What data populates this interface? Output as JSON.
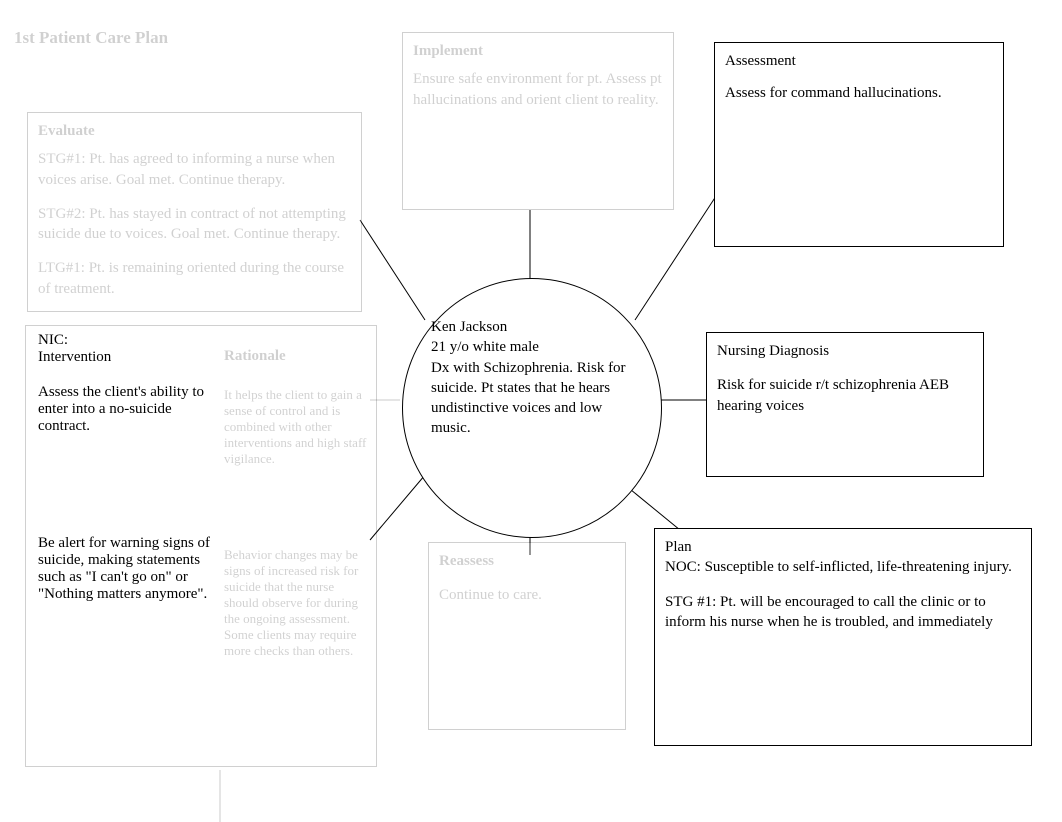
{
  "title": "1st Patient Care Plan",
  "center": {
    "name": "Ken Jackson",
    "demo": "21 y/o white male",
    "summary": "Dx with Schizophrenia. Risk for suicide. Pt states that he hears undistinctive voices and low music."
  },
  "implement": {
    "heading": "Implement",
    "body": "Ensure safe environment for pt. Assess pt hallucinations and orient client to reality."
  },
  "assessment": {
    "heading": "Assessment",
    "body": "Assess for command hallucinations."
  },
  "evaluate": {
    "heading": "Evaluate",
    "e1": "STG#1: Pt. has agreed to informing a nurse when voices arise. Goal met. Continue therapy.",
    "e2": "STG#2: Pt. has stayed in contract of not attempting suicide due to voices. Goal met. Continue therapy.",
    "e3": "LTG#1: Pt. is remaining oriented during the course of treatment."
  },
  "nursingDx": {
    "heading": "Nursing Diagnosis",
    "body": "Risk for suicide r/t schizophrenia AEB hearing voices"
  },
  "nic": {
    "heading": "NIC:",
    "sub": "Intervention",
    "p1": "Assess the client's ability to enter into a no-suicide contract.",
    "p2": "Be alert for warning signs of suicide, making statements such as \"I can't go on\" or \"Nothing matters anymore\"."
  },
  "rationale": {
    "heading": "Rationale",
    "r1": "It helps the client to gain a sense of control and is combined with other interventions and high staff vigilance.",
    "r2": "Behavior changes may be signs of increased risk for suicide that the nurse should observe for during the ongoing assessment. Some clients may require more checks than others."
  },
  "reassess": {
    "heading": "Reassess",
    "body": "Continue to care."
  },
  "plan": {
    "heading": "Plan",
    "noc": "NOC: Susceptible to self-inflicted, life-threatening injury.",
    "stg1": "STG #1: Pt. will be encouraged to call the clinic or to inform his nurse when he is troubled, and immediately"
  }
}
